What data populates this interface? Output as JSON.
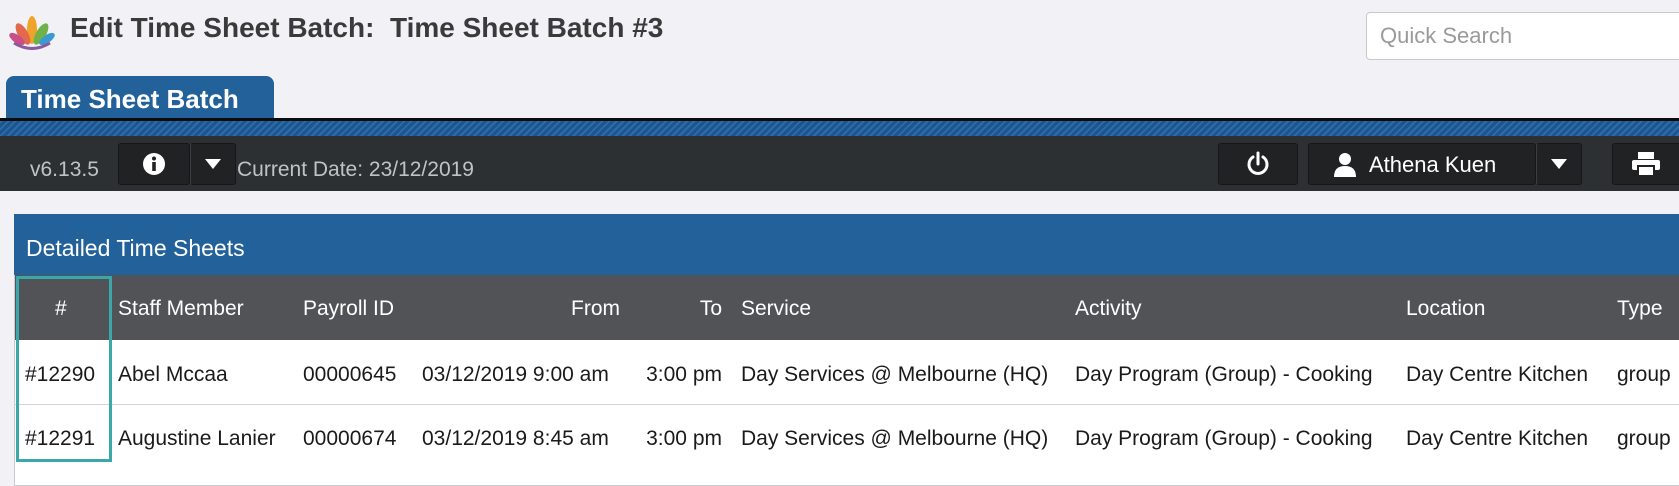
{
  "header": {
    "title": "Edit Time Sheet Batch:  Time Sheet Batch #3",
    "search_placeholder": "Quick Search",
    "logo_icon": "lotus-logo"
  },
  "tabs": [
    {
      "label": "Time Sheet Batch",
      "active": true
    }
  ],
  "toolbar": {
    "version": "v6.13.5",
    "info_icon": "info-icon",
    "current_date": "Current Date: 23/12/2019",
    "power_icon": "power-icon",
    "user_name": "Athena Kuen",
    "user_icon": "user-icon",
    "print_icon": "printer-icon"
  },
  "panel": {
    "title": "Detailed Time Sheets",
    "columns": [
      "#",
      "Staff Member",
      "Payroll ID",
      "From",
      "To",
      "Service",
      "Activity",
      "Location",
      "Type"
    ],
    "rows": [
      {
        "id": "#12290",
        "staff": "Abel Mccaa",
        "payroll": "00000645",
        "from": "03/12/2019 9:00 am",
        "to": "3:00 pm",
        "service": "Day Services @ Melbourne (HQ)",
        "activity": "Day Program (Group) - Cooking",
        "location": "Day Centre Kitchen",
        "type": "group"
      },
      {
        "id": "#12291",
        "staff": "Augustine Lanier",
        "payroll": "00000674",
        "from": "03/12/2019 8:45 am",
        "to": "3:00 pm",
        "service": "Day Services @ Melbourne (HQ)",
        "activity": "Day Program (Group) - Cooking",
        "location": "Day Centre Kitchen",
        "type": "group"
      }
    ]
  },
  "colors": {
    "accent_blue": "#23619b",
    "toolbar_dark": "#2d3033",
    "table_header": "#515356",
    "highlight": "#3aa8a8"
  }
}
